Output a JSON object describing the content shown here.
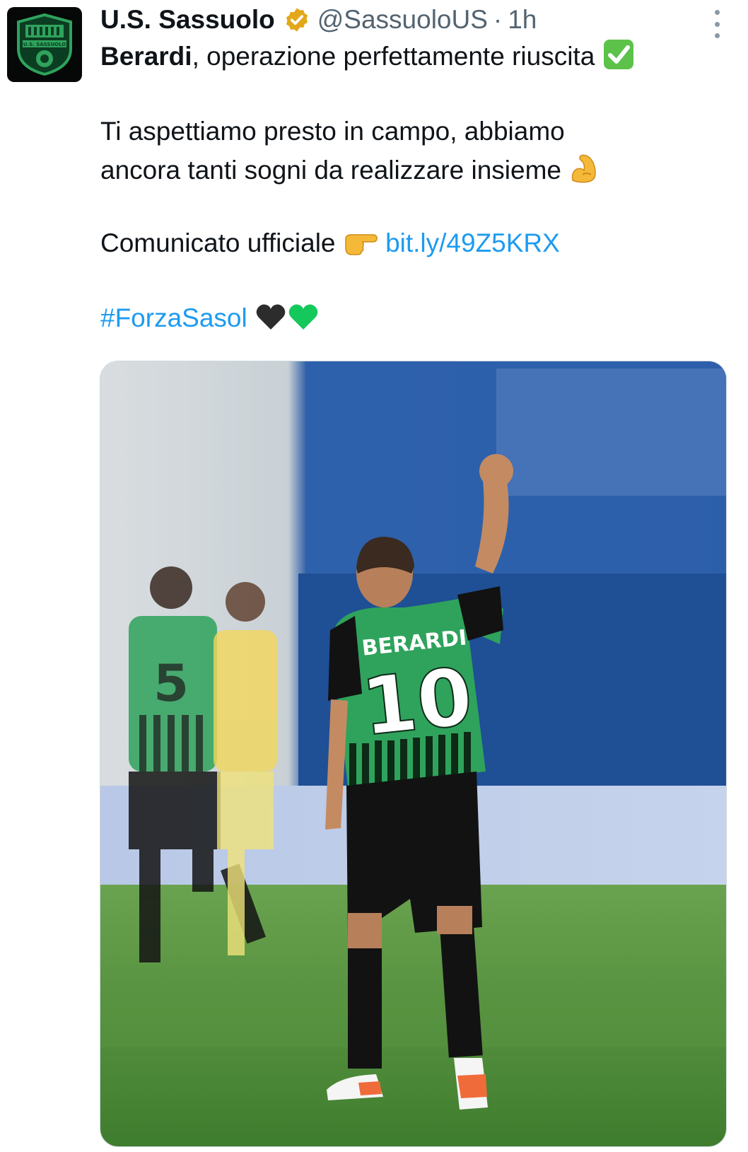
{
  "author": {
    "display_name": "U.S. Sassuolo",
    "handle": "@SassuoloUS",
    "separator": "·",
    "time": "1h",
    "avatar_icon": "sassuolo-crest-icon",
    "avatar_crest_text": "U.S. SASSUOLO"
  },
  "tweet": {
    "line1_bold": "Berardi",
    "line1_rest": ", operazione perfettamente riuscita",
    "line1_emoji": "check-mark-button-icon",
    "line2": "Ti aspettiamo presto in campo, abbiamo",
    "line3": "ancora tanti sogni da realizzare insieme",
    "line3_emoji": "flexed-biceps-icon",
    "line4_text": "Comunicato ufficiale",
    "line4_emoji": "pointing-right-icon",
    "link": "bit.ly/49Z5KRX",
    "hashtag": "#ForzaSasol",
    "hashtag_emojis": [
      "black-heart-icon",
      "green-heart-icon"
    ]
  },
  "media": {
    "jersey_name": "BERARDI",
    "jersey_number": "10",
    "teammate_number": "5",
    "colors": {
      "green": "#2fa35c",
      "black": "#111111",
      "pitch": "#4f8f3a",
      "stand_blue": "#1f4f95"
    }
  },
  "colors": {
    "link": "#1d9bf0",
    "muted": "#536471",
    "verified_gold": "#e2a81a"
  }
}
